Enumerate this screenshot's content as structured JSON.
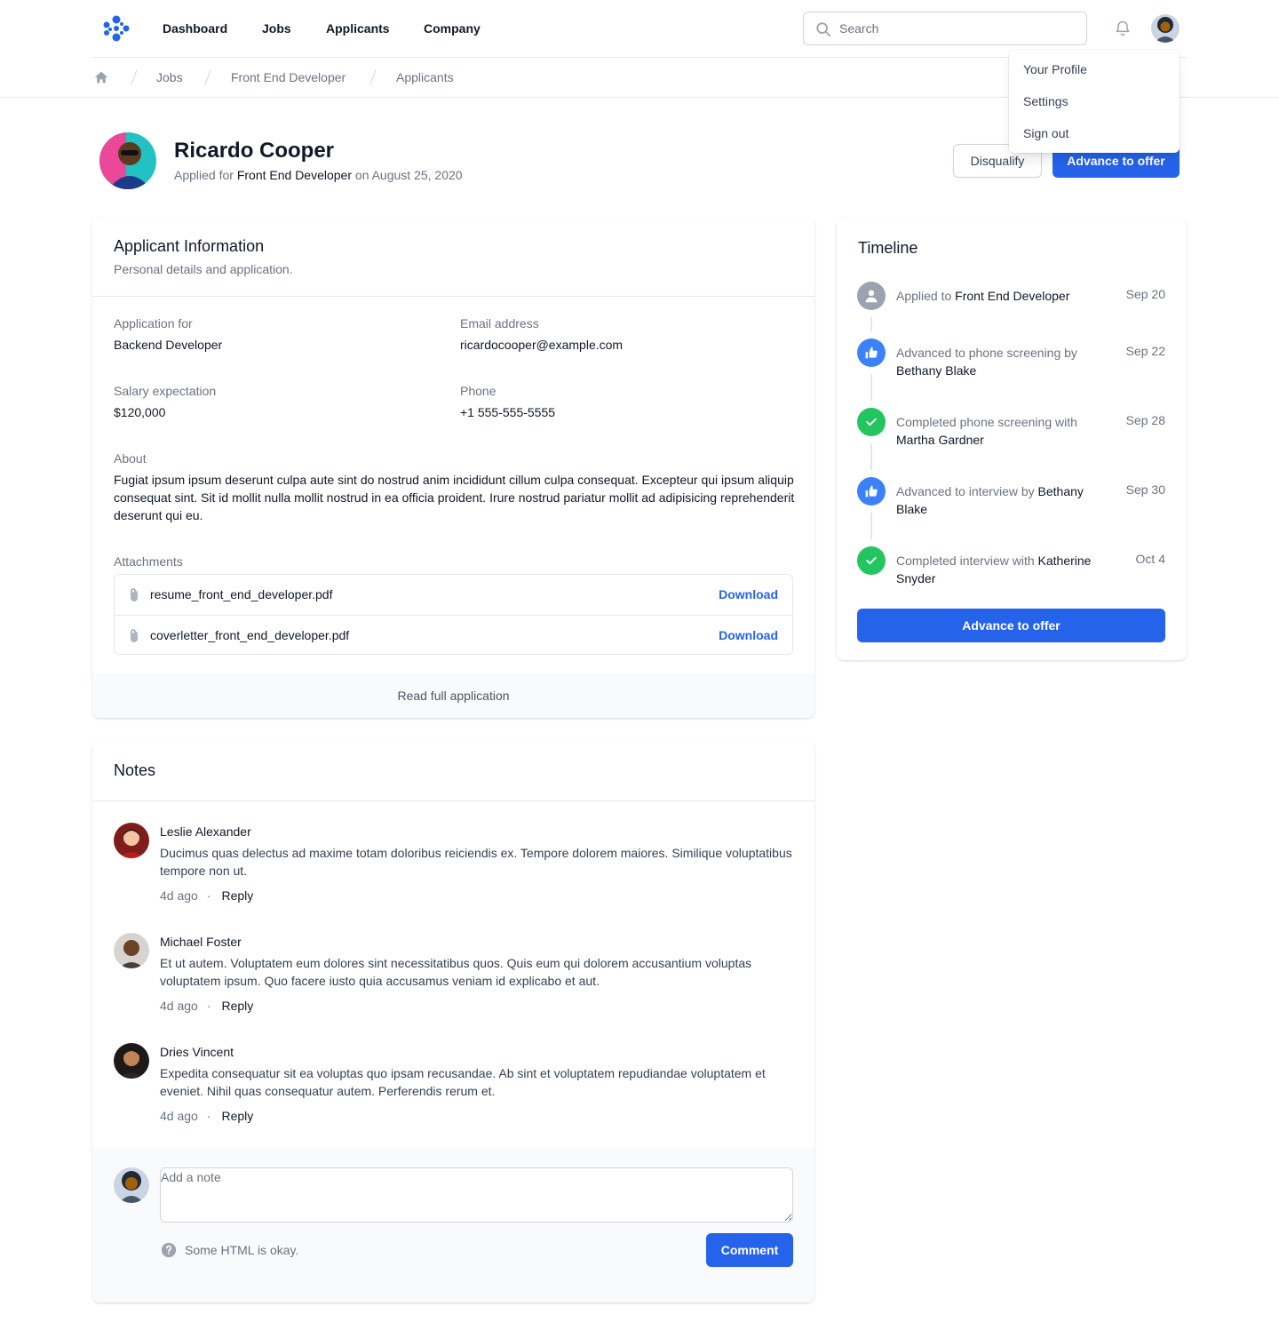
{
  "nav": {
    "links": [
      "Dashboard",
      "Jobs",
      "Applicants",
      "Company"
    ],
    "search_placeholder": "Search"
  },
  "breadcrumbs": [
    "Jobs",
    "Front End Developer",
    "Applicants"
  ],
  "user_menu": [
    "Your Profile",
    "Settings",
    "Sign out"
  ],
  "applicant": {
    "name": "Ricardo Cooper",
    "applied_prefix": "Applied for",
    "applied_job": "Front End Developer",
    "applied_on": "on August 25, 2020",
    "disqualify_label": "Disqualify",
    "advance_label": "Advance to offer"
  },
  "info": {
    "title": "Applicant Information",
    "subtitle": "Personal details and application.",
    "fields": [
      {
        "label": "Application for",
        "value": "Backend Developer"
      },
      {
        "label": "Email address",
        "value": "ricardocooper@example.com"
      },
      {
        "label": "Salary expectation",
        "value": "$120,000"
      },
      {
        "label": "Phone",
        "value": "+1 555-555-5555"
      }
    ],
    "about_label": "About",
    "about": "Fugiat ipsum ipsum deserunt culpa aute sint do nostrud anim incididunt cillum culpa consequat. Excepteur qui ipsum aliquip consequat sint. Sit id mollit nulla mollit nostrud in ea officia proident. Irure nostrud pariatur mollit ad adipisicing reprehenderit deserunt qui eu.",
    "attachments_label": "Attachments",
    "attachments": [
      {
        "name": "resume_front_end_developer.pdf",
        "action": "Download"
      },
      {
        "name": "coverletter_front_end_developer.pdf",
        "action": "Download"
      }
    ],
    "read_full": "Read full application"
  },
  "timeline": {
    "title": "Timeline",
    "events": [
      {
        "text": "Applied to",
        "target": "Front End Developer",
        "date": "Sep 20",
        "icon": "user-icon",
        "color": "#9ca3af"
      },
      {
        "text": "Advanced to phone screening by",
        "target": "Bethany Blake",
        "date": "Sep 22",
        "icon": "thumb-up-icon",
        "color": "#3b82f6"
      },
      {
        "text": "Completed phone screening with",
        "target": "Martha Gardner",
        "date": "Sep 28",
        "icon": "check-icon",
        "color": "#22c55e"
      },
      {
        "text": "Advanced to interview by",
        "target": "Bethany Blake",
        "date": "Sep 30",
        "icon": "thumb-up-icon",
        "color": "#3b82f6"
      },
      {
        "text": "Completed interview with",
        "target": "Katherine Snyder",
        "date": "Oct 4",
        "icon": "check-icon",
        "color": "#22c55e"
      }
    ],
    "button": "Advance to offer"
  },
  "notes": {
    "title": "Notes",
    "items": [
      {
        "author": "Leslie Alexander",
        "body": "Ducimus quas delectus ad maxime totam doloribus reiciendis ex. Tempore dolorem maiores. Similique voluptatibus tempore non ut.",
        "time": "4d ago",
        "reply": "Reply"
      },
      {
        "author": "Michael Foster",
        "body": "Et ut autem. Voluptatem eum dolores sint necessitatibus quos. Quis eum qui dolorem accusantium voluptas voluptatem ipsum. Quo facere iusto quia accusamus veniam id explicabo et aut.",
        "time": "4d ago",
        "reply": "Reply"
      },
      {
        "author": "Dries Vincent",
        "body": "Expedita consequatur sit ea voluptas quo ipsam recusandae. Ab sint et voluptatem repudiandae voluptatem et eveniet. Nihil quas consequatur autem. Perferendis rerum et.",
        "time": "4d ago",
        "reply": "Reply"
      }
    ],
    "placeholder": "Add a note",
    "hint": "Some HTML is okay.",
    "comment_label": "Comment"
  },
  "colors": {
    "primary": "#2563eb",
    "success": "#22c55e",
    "info": "#3b82f6",
    "muted": "#9ca3af"
  }
}
